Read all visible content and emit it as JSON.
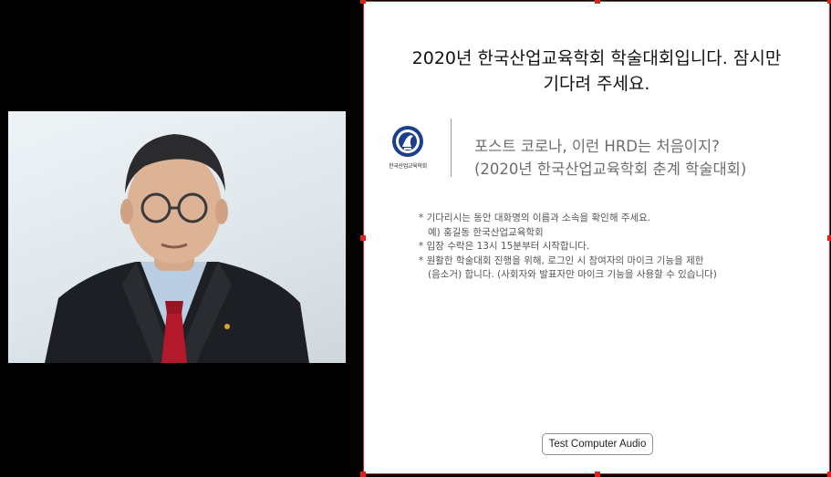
{
  "waiting_room": {
    "title_line1": "2020년 한국산업교육학회 학술대회입니다. 잠시만",
    "title_line2": "기다려 주세요.",
    "logo_text": "한국산업교육학회",
    "event_line1": "포스트 코로나, 이런 HRD는 처음이지?",
    "event_line2": "(2020년 한국산업교육학회 춘계 학술대회)",
    "notes": [
      "* 기다리시는 동안 대화명의 이름과 소속을 확인해 주세요.",
      "예) 홍길동 한국산업교육학회",
      "* 입장 수락은 13시 15분부터 시작합니다.",
      "* 원활한 학술대회 진행을 위해, 로그인 시 참여자의 마이크 기능을 제한",
      "(음소거) 합니다. (사회자와 발표자만 마이크 기능을 사용할 수 있습니다)"
    ],
    "audio_button": "Test Computer Audio"
  },
  "colors": {
    "selection_border": "#e0201c",
    "event_text": "#6d6d6d",
    "logo_blue": "#1a3f8c",
    "tie": "#b3192b"
  },
  "icons": {
    "logo": "society-emblem-icon"
  }
}
